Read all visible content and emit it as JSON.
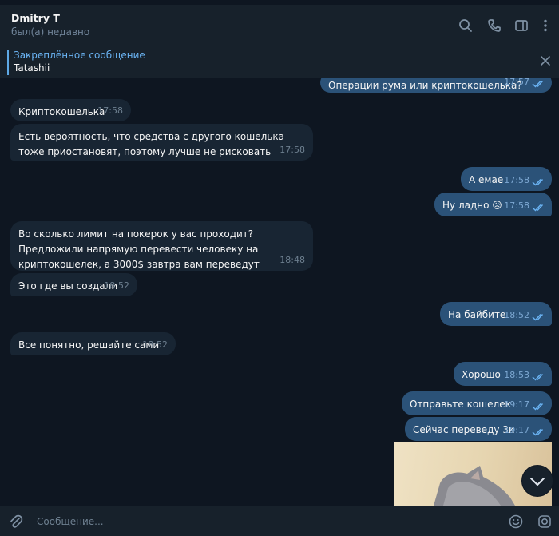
{
  "header": {
    "chat_name": "Dmitry T",
    "status": "был(а) недавно",
    "icons": [
      "search-icon",
      "phone-icon",
      "sidebar-toggle-icon",
      "more-icon"
    ]
  },
  "pinned": {
    "title": "Закреплённое сообщение",
    "text": "Tatashii"
  },
  "messages": [
    {
      "dir": "out",
      "text": "Операции рума или криптокошелька?",
      "time": "17:57",
      "read": true
    },
    {
      "dir": "in",
      "text": "Криптокошелька",
      "time": "17:58"
    },
    {
      "dir": "in",
      "text": "Есть вероятность, что средства с другого кошелька тоже приостановят, поэтому лучше не рисковать",
      "time": "17:58"
    },
    {
      "dir": "out",
      "text": "А емае",
      "time": "17:58",
      "read": true
    },
    {
      "dir": "out",
      "text": "Ну ладно 😥",
      "time": "17:58",
      "read": true
    },
    {
      "dir": "in",
      "text": "Во сколько лимит на покерок у вас проходит? Предложили напрямую перевести человеку на криптокошелек, а 3000$ завтра вам переведут",
      "time": "18:48"
    },
    {
      "dir": "in",
      "text": "Это где вы создали",
      "time": "18:52"
    },
    {
      "dir": "out",
      "text": "На байбите",
      "time": "18:52",
      "read": true
    },
    {
      "dir": "in",
      "text": "Все понятно, решайте сами",
      "time": "18:52"
    },
    {
      "dir": "out",
      "text": "Хорошо",
      "time": "18:53",
      "read": true
    },
    {
      "dir": "out",
      "text": "Отправьте кошелек",
      "time": "19:17",
      "read": true
    },
    {
      "dir": "out",
      "text": "Сейчас переведу 3к",
      "time": "19:17",
      "read": true
    }
  ],
  "composer": {
    "placeholder": "Сообщение...",
    "icons": [
      "attach-icon",
      "emoji-icon",
      "camera-icon"
    ]
  },
  "colors": {
    "background": "#0e1621",
    "panel": "#17212b",
    "incoming_bubble": "#182533",
    "outgoing_bubble": "#2b5278",
    "accent": "#6ab3f3"
  }
}
